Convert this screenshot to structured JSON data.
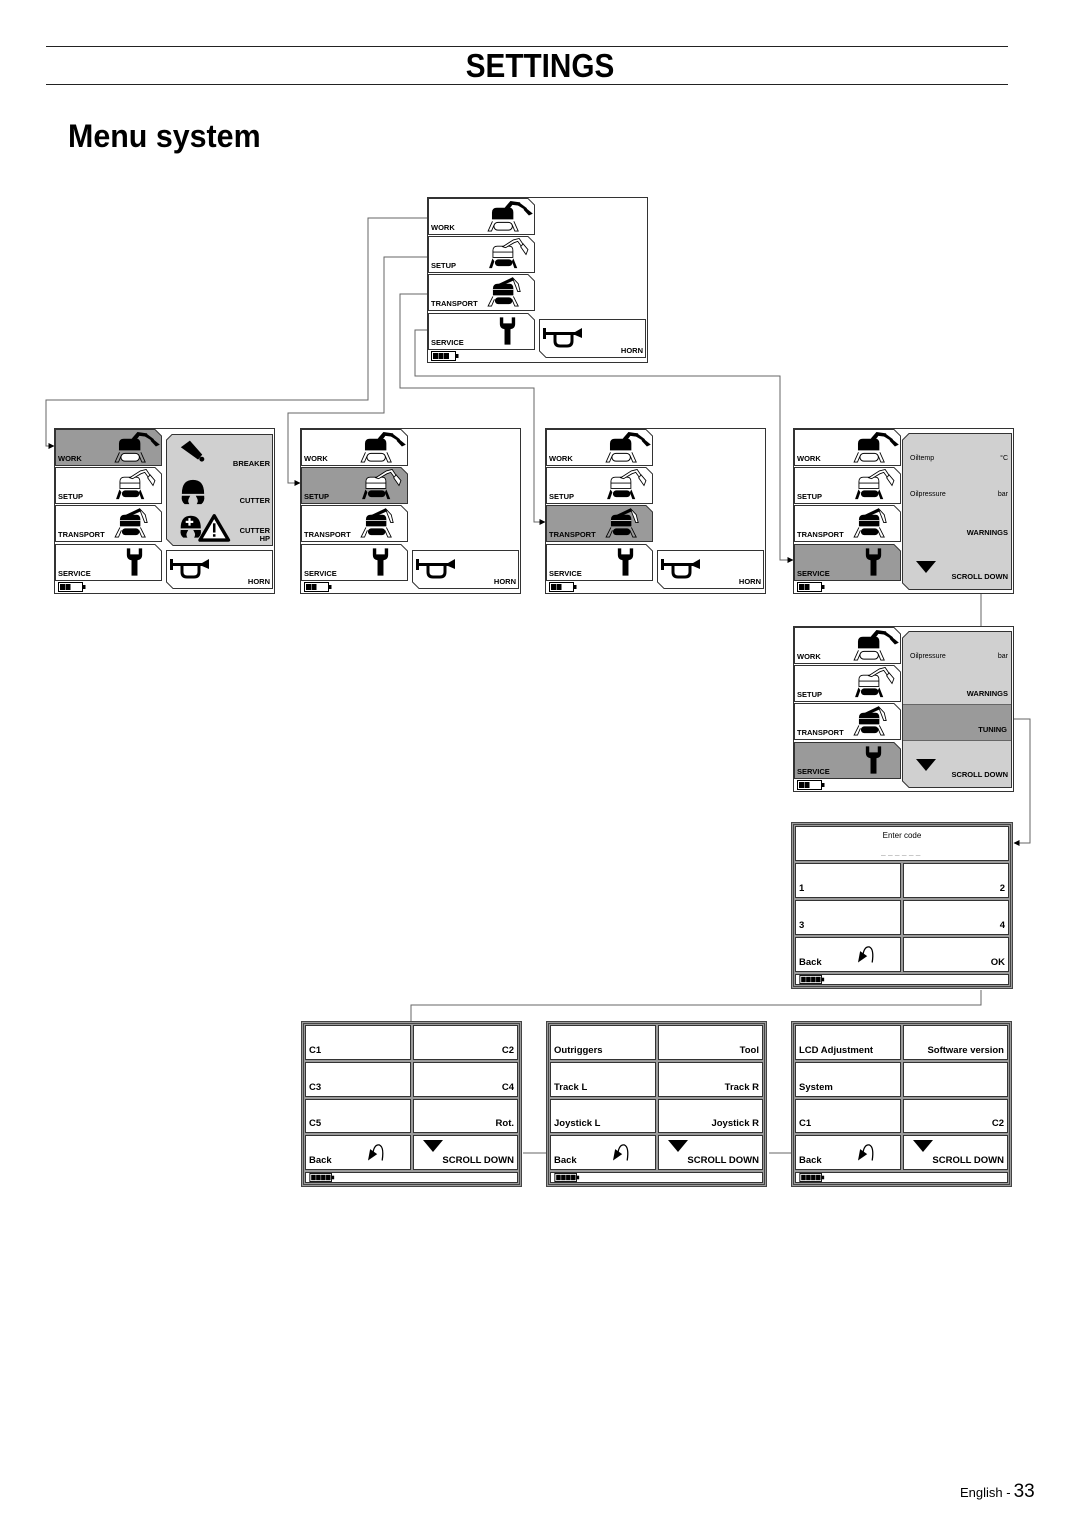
{
  "header": {
    "section_title": "SETTINGS",
    "page_title": "Menu system"
  },
  "footer": {
    "language": "English -",
    "page_number": "33"
  },
  "colors": {
    "selected_tile": "#9a9a9a",
    "submenu_panel": "#d0d0d0",
    "tile": "#ffffff",
    "frame": "#333333",
    "connector": "#666666"
  },
  "main_menu": {
    "items": [
      {
        "key": "work",
        "label": "WORK",
        "icon": "work-excavator-icon"
      },
      {
        "key": "setup",
        "label": "SETUP",
        "icon": "setup-excavator-icon"
      },
      {
        "key": "transport",
        "label": "TRANSPORT",
        "icon": "transport-excavator-icon"
      },
      {
        "key": "service",
        "label": "SERVICE",
        "icon": "wrench-icon"
      }
    ],
    "horn": {
      "label": "HORN",
      "icon": "horn-icon"
    }
  },
  "screens": [
    {
      "id": "main",
      "type": "menu",
      "selected": null,
      "battery_level": 0.75,
      "horn": true
    },
    {
      "id": "work",
      "type": "menu",
      "selected": "work",
      "battery_level": 0.5,
      "horn": true,
      "tools": [
        {
          "label": "BREAKER",
          "icon": "breaker-icon"
        },
        {
          "label": "CUTTER",
          "icon": "cutter-icon"
        },
        {
          "label": "CUTTER",
          "sub_label": "HP",
          "icon": "cutter-hp-icon"
        }
      ]
    },
    {
      "id": "setup",
      "type": "menu",
      "selected": "setup",
      "battery_level": 0.5,
      "horn": true
    },
    {
      "id": "transport",
      "type": "menu",
      "selected": "transport",
      "battery_level": 0.5,
      "horn": true
    },
    {
      "id": "service_1",
      "type": "menu",
      "selected": "service",
      "battery_level": 0.5,
      "horn": false,
      "info": [
        {
          "kind": "value",
          "label": "Oiltemp",
          "unit": "°C"
        },
        {
          "kind": "value",
          "label": "Oilpressure",
          "unit": "bar"
        },
        {
          "kind": "action",
          "label": "WARNINGS"
        },
        {
          "kind": "scroll",
          "label": "SCROLL DOWN",
          "icon": "scroll-down-icon"
        }
      ]
    },
    {
      "id": "service_2",
      "type": "menu",
      "selected": "service",
      "battery_level": 0.5,
      "horn": false,
      "info": [
        {
          "kind": "value",
          "label": "Oilpressure",
          "unit": "bar"
        },
        {
          "kind": "action",
          "label": "WARNINGS"
        },
        {
          "kind": "action",
          "label": "TUNING",
          "highlighted": true
        },
        {
          "kind": "scroll",
          "label": "SCROLL DOWN",
          "icon": "scroll-down-icon"
        }
      ]
    },
    {
      "id": "code_entry",
      "type": "code",
      "title": "Enter code",
      "code_mask": "______",
      "rows": [
        [
          "1",
          "2"
        ],
        [
          "3",
          "4"
        ]
      ],
      "back_label": "Back",
      "confirm_label": "OK",
      "battery_level": 1.0
    },
    {
      "id": "tuning_1",
      "type": "list",
      "rows": [
        [
          "C1",
          "C2"
        ],
        [
          "C3",
          "C4"
        ],
        [
          "C5",
          "Rot."
        ]
      ],
      "back_label": "Back",
      "scroll_label": "SCROLL DOWN",
      "battery_level": 1.0
    },
    {
      "id": "tuning_2",
      "type": "list",
      "rows": [
        [
          "Outriggers",
          "Tool"
        ],
        [
          "Track L",
          "Track R"
        ],
        [
          "Joystick L",
          "Joystick R"
        ]
      ],
      "back_label": "Back",
      "scroll_label": "SCROLL DOWN",
      "battery_level": 1.0
    },
    {
      "id": "tuning_3",
      "type": "list",
      "rows": [
        [
          "LCD Adjustment",
          "Software version"
        ],
        [
          "System",
          ""
        ],
        [
          "C1",
          "C2"
        ]
      ],
      "back_label": "Back",
      "scroll_label": "SCROLL DOWN",
      "battery_level": 1.0
    }
  ],
  "flows": [
    {
      "from": "main.work",
      "to": "work"
    },
    {
      "from": "main.setup",
      "to": "setup"
    },
    {
      "from": "main.transport",
      "to": "transport"
    },
    {
      "from": "main.service",
      "to": "service_1"
    },
    {
      "from": "service_1.scroll_down",
      "to": "service_2"
    },
    {
      "from": "service_2.tuning",
      "to": "code_entry"
    },
    {
      "from": "code_entry.ok",
      "to": "tuning_1"
    },
    {
      "from": "tuning_1.scroll_down",
      "to": "tuning_2"
    },
    {
      "from": "tuning_2.scroll_down",
      "to": "tuning_3"
    }
  ]
}
